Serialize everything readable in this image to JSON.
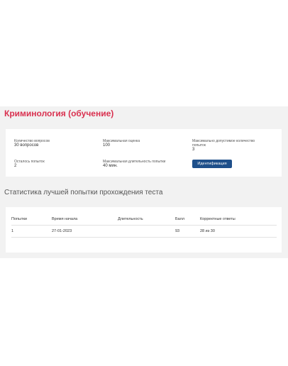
{
  "page": {
    "title": "Криминология (обучение)"
  },
  "info": {
    "question_count_label": "Количество вопросов",
    "question_count_value": "30 вопросов",
    "max_score_label": "Максимальная оценка",
    "max_score_value": "100",
    "max_attempts_label": "Максимально допустимое количество попыток",
    "max_attempts_value": "3",
    "attempts_left_label": "Осталось попыток",
    "attempts_left_value": "2",
    "max_duration_label": "Максимальная длительность попытки",
    "max_duration_value": "40 мин.",
    "identify_button": "Идентификация"
  },
  "stats": {
    "heading": "Статистика лучшей попытки прохождения теста",
    "columns": [
      "Попытки",
      "Время начала",
      "Длительность",
      "Балл",
      "Корректные ответы"
    ],
    "rows": [
      [
        "1",
        "27-01-2023",
        "",
        "93",
        "28 из 30"
      ]
    ]
  },
  "colors": {
    "title": "#d9304f",
    "button": "#1e4f8a",
    "panel_background": "#f2f2f2"
  }
}
